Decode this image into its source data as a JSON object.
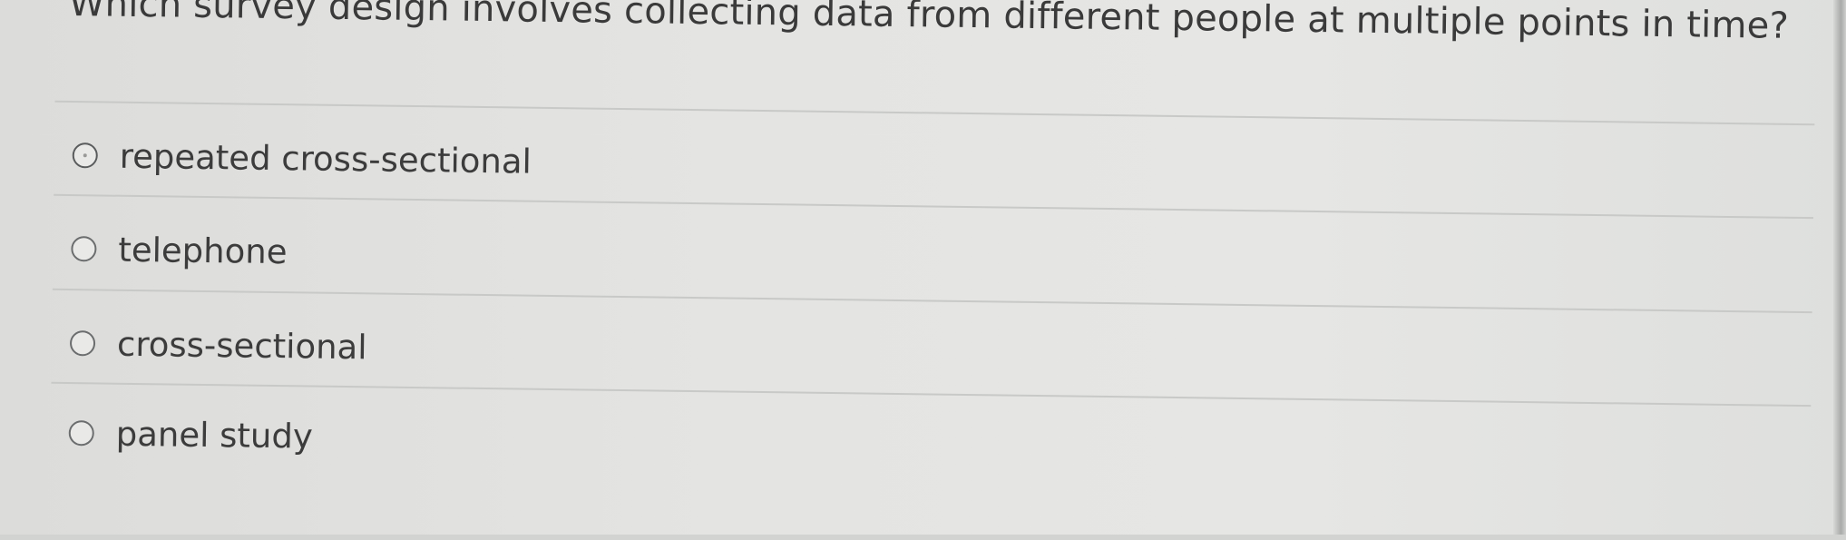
{
  "question": {
    "text": "Which survey design involves collecting data from different people at multiple points in time?"
  },
  "options": [
    {
      "label": "repeated cross-sectional",
      "selected": false
    },
    {
      "label": "telephone",
      "selected": false
    },
    {
      "label": "cross-sectional",
      "selected": false
    },
    {
      "label": "panel study",
      "selected": false
    }
  ]
}
